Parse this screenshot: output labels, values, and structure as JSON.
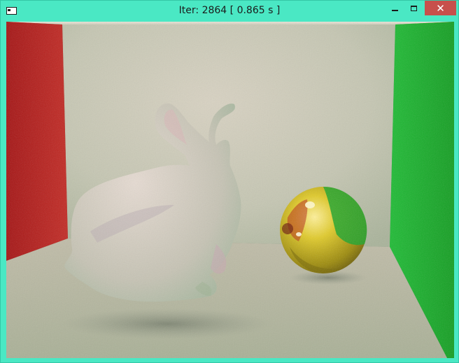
{
  "window": {
    "title": "Iter: 2864 [ 0.865 s ]",
    "icons": {
      "app": "window-app-icon",
      "minimize": "minimize-icon",
      "maximize": "maximize-icon",
      "close": "close-icon"
    },
    "colors": {
      "frame": "#4ae8c4",
      "close_button": "#c7504b"
    }
  },
  "render": {
    "scene": "path-traced cornell box",
    "iterations": 2864,
    "time": "0.865 s",
    "colors": {
      "left_wall": "#b01a1a",
      "right_wall": "#16b02a",
      "back_wall": "#cfcbbb",
      "floor": "#bbb6a4",
      "ceiling": "#dcd7c8",
      "sphere": "#d8c41a"
    }
  }
}
